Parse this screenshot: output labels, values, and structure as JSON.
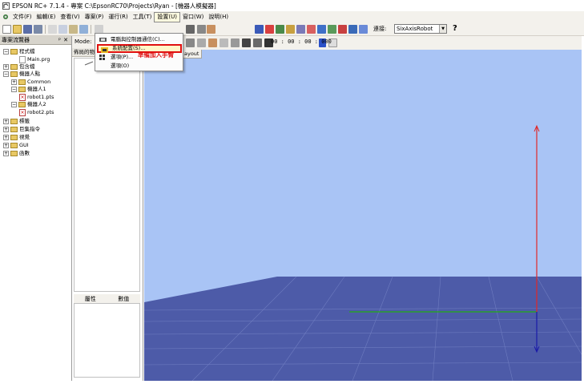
{
  "window": {
    "title": "EPSON RC+ 7.1.4 - 專案 C:\\EpsonRC70\\Projects\\Ryan - [機器人模擬器]"
  },
  "menubar": {
    "items": [
      "文件(F)",
      "編輯(E)",
      "查看(V)",
      "專案(P)",
      "運行(R)",
      "工具(T)",
      "設置(U)",
      "窗口(W)",
      "說明(H)"
    ]
  },
  "toolbar": {
    "connection_label": "連接:",
    "robot_selected": "SixAxisRobot",
    "help_label": "?"
  },
  "explorer": {
    "title": "專案流覽器",
    "pin_label": "ᵖ",
    "close_label": "✕",
    "tree": [
      {
        "label": "程式檔",
        "type": "folder",
        "expanded": true
      },
      {
        "label": "Main.prg",
        "type": "file"
      },
      {
        "label": "包含檔",
        "type": "folder"
      },
      {
        "label": "機器人點",
        "type": "folder",
        "expanded": true
      },
      {
        "label": "Common",
        "type": "folder"
      },
      {
        "label": "機器人1",
        "type": "folder",
        "expanded": true
      },
      {
        "label": "robot1.pts",
        "type": "pts"
      },
      {
        "label": "機器人2",
        "type": "folder",
        "expanded": true
      },
      {
        "label": "robot2.pts",
        "type": "pts"
      },
      {
        "label": "標籤",
        "type": "folder"
      },
      {
        "label": "巨集指令",
        "type": "folder"
      },
      {
        "label": "視覺",
        "type": "folder"
      },
      {
        "label": "GUI",
        "type": "folder"
      },
      {
        "label": "函數",
        "type": "folder"
      }
    ]
  },
  "midpanel": {
    "mode_label": "Mode:",
    "layout_label": "佈局的物",
    "prop_col1": "屬性",
    "prop_col2": "數值"
  },
  "viewport": {
    "timer": "00 : 00 : 00 : 000",
    "tab_label": "ayout",
    "bg_color": "#a9c4f5",
    "floor_color": "#4d5ba8"
  },
  "dropdown": {
    "items": [
      {
        "label": "電腦與控制器通信(C)...",
        "icon": "connect-icon",
        "highlighted": false
      },
      {
        "label": "系統配置(S)...",
        "icon": "system-config-icon",
        "highlighted": true
      },
      {
        "label": "選項(P)...",
        "icon": "options-grid-icon",
        "highlighted": false
      },
      {
        "label": "選項(O)",
        "icon": "none",
        "highlighted": false
      }
    ],
    "annotation": "準備加入手臂",
    "annotation_color": "#e01010"
  }
}
